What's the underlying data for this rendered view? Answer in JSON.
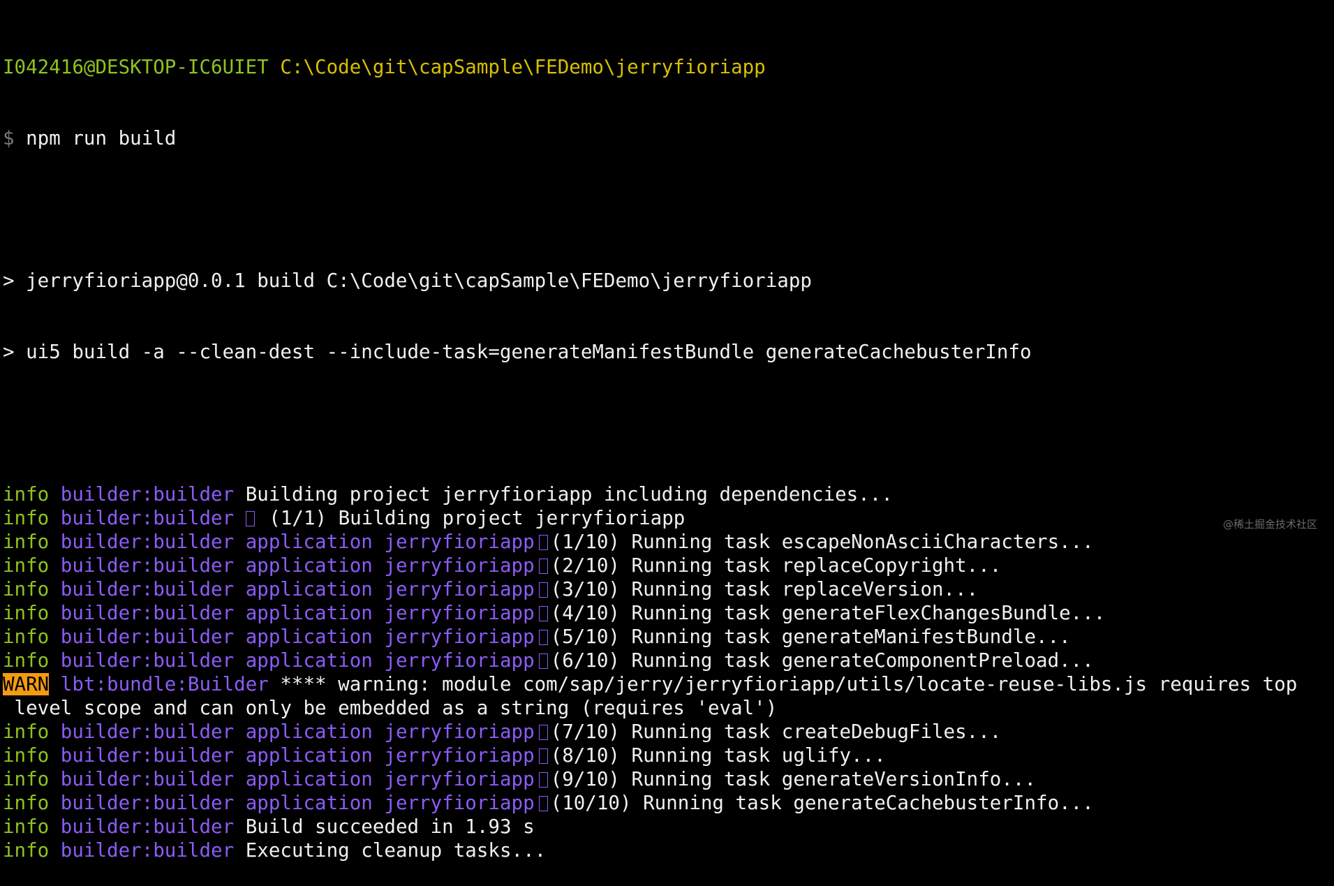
{
  "prompt": {
    "user_host": "I042416@DESKTOP-IC6UIET",
    "path": "C:\\Code\\git\\capSample\\FEDemo\\jerryfioriapp",
    "dollar": "$",
    "command": "npm run build"
  },
  "npm_output": [
    "> jerryfioriapp@0.0.1 build C:\\Code\\git\\capSample\\FEDemo\\jerryfioriapp",
    "> ui5 build -a --clean-dest --include-task=generateManifestBundle generateCachebusterInfo"
  ],
  "log": {
    "info_label": "info",
    "warn_label": "WARN",
    "builder_label": "builder:builder",
    "application_label": "application",
    "project_label": "jerryfioriapp",
    "lbt_label": "lbt:bundle:Builder",
    "lines": [
      {
        "type": "plain",
        "text": "Building project jerryfioriapp including dependencies..."
      },
      {
        "type": "project",
        "text": "(1/1) Building project jerryfioriapp"
      },
      {
        "type": "task",
        "text": "(1/10) Running task escapeNonAsciiCharacters..."
      },
      {
        "type": "task",
        "text": "(2/10) Running task replaceCopyright..."
      },
      {
        "type": "task",
        "text": "(3/10) Running task replaceVersion..."
      },
      {
        "type": "task",
        "text": "(4/10) Running task generateFlexChangesBundle..."
      },
      {
        "type": "task",
        "text": "(5/10) Running task generateManifestBundle..."
      },
      {
        "type": "task",
        "text": "(6/10) Running task generateComponentPreload..."
      },
      {
        "type": "warn",
        "text": "**** warning: module com/sap/jerry/jerryfioriapp/utils/locate-reuse-libs.js requires top",
        "continuation": " level scope and can only be embedded as a string (requires 'eval')"
      },
      {
        "type": "task",
        "text": "(7/10) Running task createDebugFiles..."
      },
      {
        "type": "task",
        "text": "(8/10) Running task uglify..."
      },
      {
        "type": "task",
        "text": "(9/10) Running task generateVersionInfo..."
      },
      {
        "type": "task",
        "text": "(10/10) Running task generateCachebusterInfo..."
      },
      {
        "type": "plain",
        "text": "Build succeeded in 1.93 s"
      },
      {
        "type": "plain",
        "text": "Executing cleanup tasks..."
      }
    ]
  },
  "icons": {
    "task_glyph": "missing-glyph-box-icon"
  },
  "colors": {
    "background": "#000000",
    "info": "#8fc31f",
    "path": "#d7c000",
    "module": "#8b5cf6",
    "warn_bg": "#f39c12",
    "text": "#f0f0f0"
  },
  "watermark": "@稀土掘金技术社区"
}
